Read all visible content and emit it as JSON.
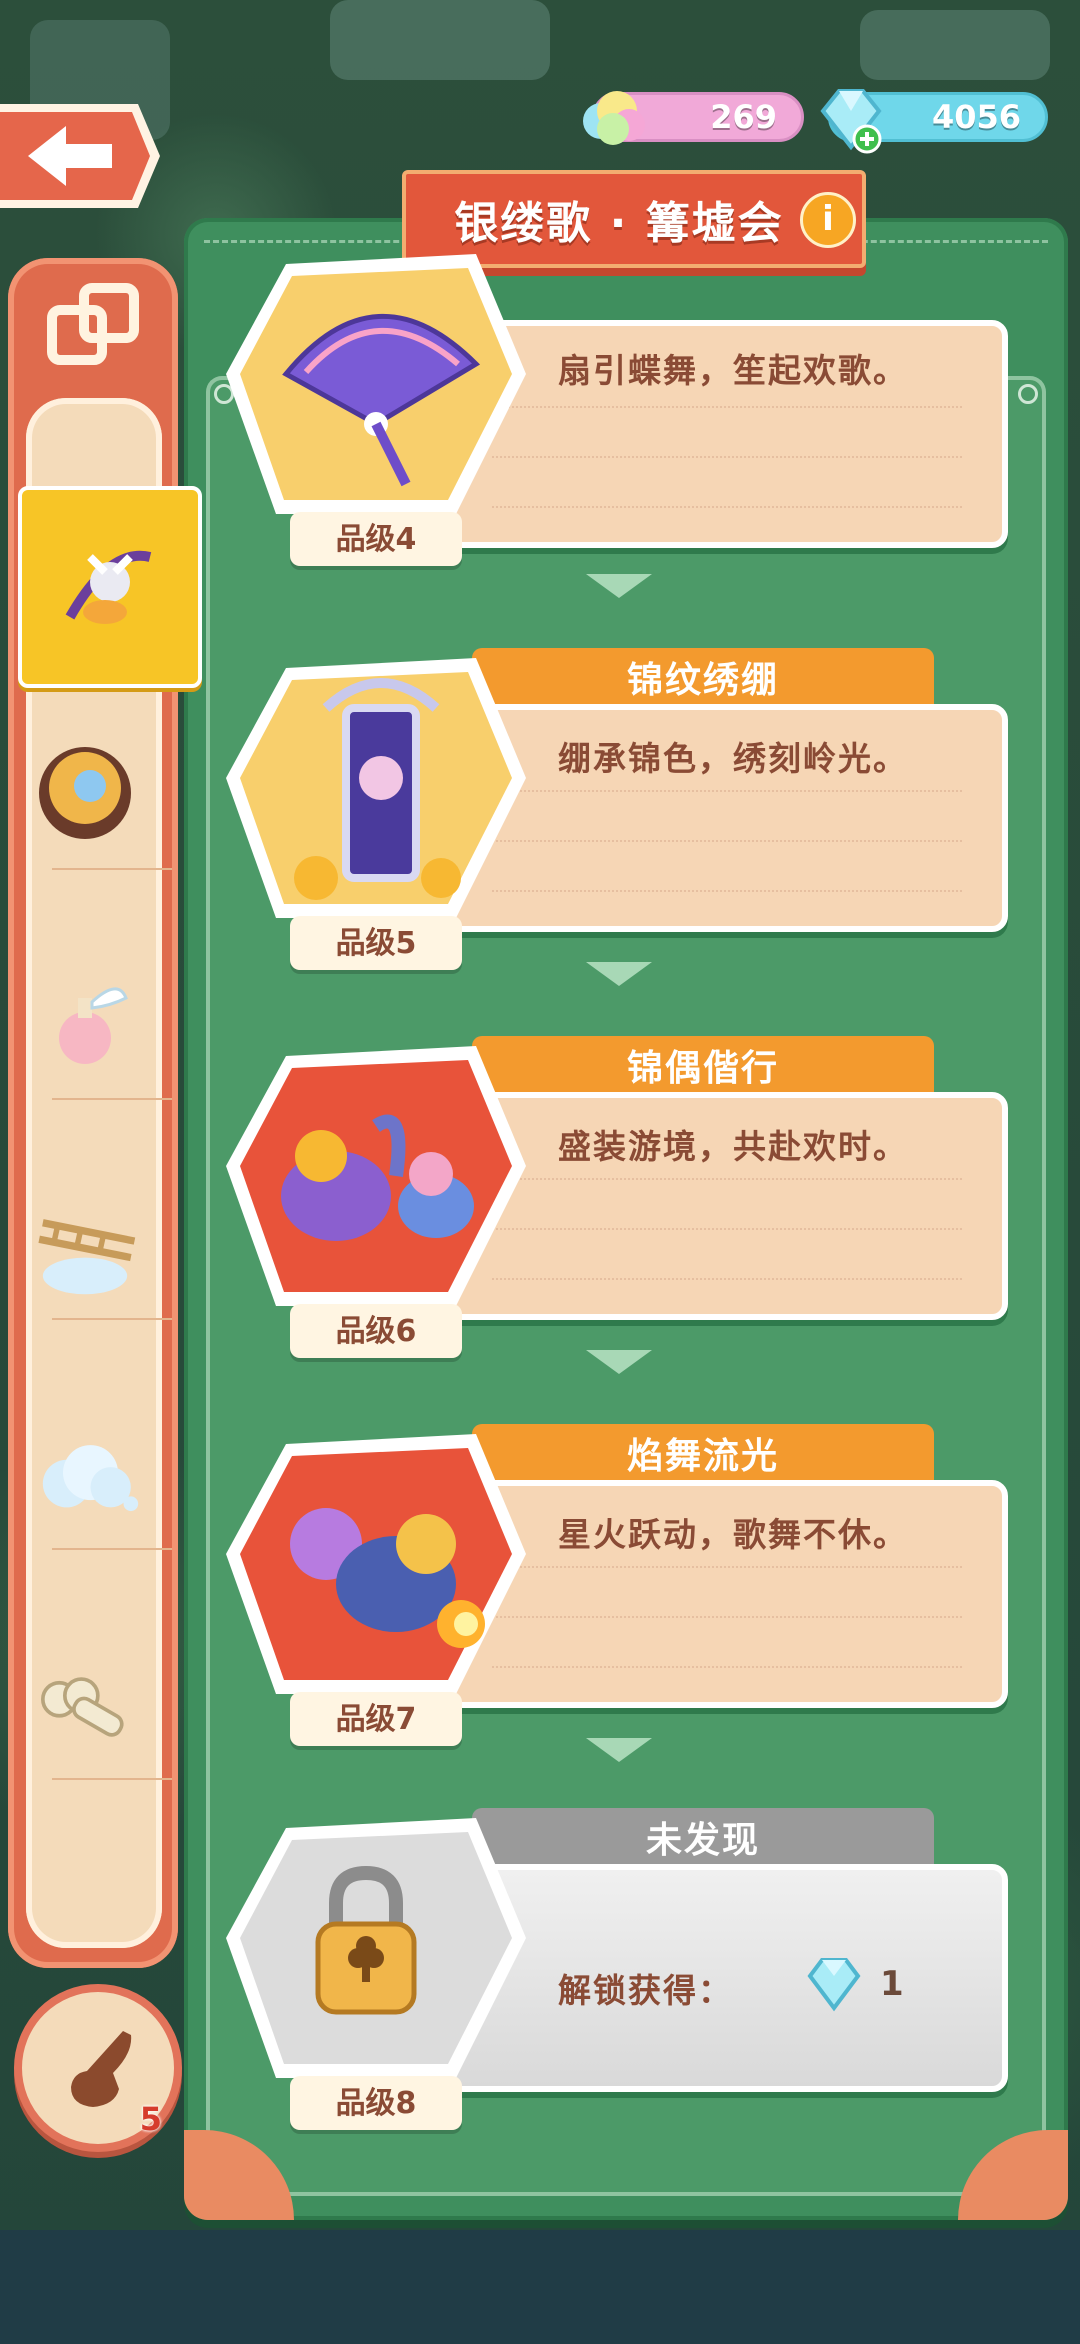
{
  "header": {
    "title": "银缕歌 · 篝墟会",
    "info_label": "i"
  },
  "resources": {
    "candy": "269",
    "gems": "4056"
  },
  "sidebar": {
    "badge_count": "5",
    "items": [
      {
        "name": "bow-item",
        "selected": true
      },
      {
        "name": "flower-ball-item",
        "selected": false
      },
      {
        "name": "winged-potion-item",
        "selected": false
      },
      {
        "name": "cloud-ladder-item",
        "selected": false
      },
      {
        "name": "cloud-item",
        "selected": false
      },
      {
        "name": "bone-key-item",
        "selected": false
      }
    ]
  },
  "cards": [
    {
      "title": "",
      "desc": "扇引蝶舞，笙起欢歌。",
      "grade": "品级4",
      "bg": "#f8cf6c"
    },
    {
      "title": "锦纹绣绷",
      "desc": "绷承锦色，绣刻岭光。",
      "grade": "品级5",
      "bg": "#f8cf6c"
    },
    {
      "title": "锦偶偕行",
      "desc": "盛装游境，共赴欢时。",
      "grade": "品级6",
      "bg": "#e8533a"
    },
    {
      "title": "焰舞流光",
      "desc": "星火跃动，歌舞不休。",
      "grade": "品级7",
      "bg": "#e8533a"
    },
    {
      "title": "未发现",
      "desc": "",
      "grade": "品级8",
      "bg": "#dcdcdc",
      "unlock_label": "解锁获得：",
      "unlock_value": "1"
    }
  ],
  "colors": {
    "panel_green": "#3f8f5e",
    "tab_orange": "#f39a2e",
    "title_red": "#e2573b",
    "card_cream": "#f6d6b5"
  }
}
